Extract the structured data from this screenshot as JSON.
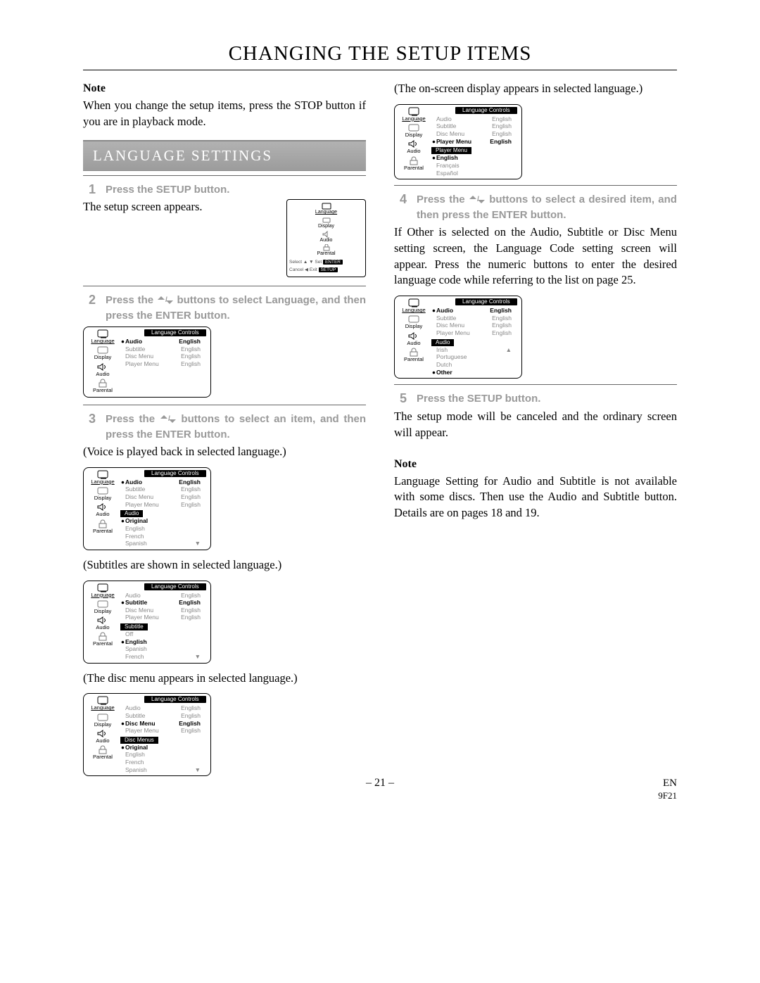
{
  "chapterTitle": "CHANGING THE SETUP ITEMS",
  "left": {
    "noteHead": "Note",
    "noteBody": "When you change the setup items, press the STOP button if you are in playback mode.",
    "sectionTitle": "LANGUAGE SETTINGS",
    "step1": {
      "num": "1",
      "txt": "Press the SETUP button.",
      "after": "The setup screen appears."
    },
    "miniOsd": {
      "items": [
        "Language",
        "Display",
        "Audio",
        "Parental"
      ],
      "footLeft": "Select",
      "footLeftTag": "ENTER",
      "footRight": "Cancel",
      "footRightTag": "SETUP",
      "exit": "Exit"
    },
    "step2": {
      "num": "2",
      "txt_a": "Press the ",
      "txt_b": " buttons to select Language, and then press the ENTER button."
    },
    "osd1": {
      "sideActive": "Language",
      "title": "Language Controls",
      "rows": [
        {
          "k": "Audio",
          "v": "English",
          "hl": true,
          "bullet": true
        },
        {
          "k": "Subtitle",
          "v": "English",
          "dim": true
        },
        {
          "k": "Disc Menu",
          "v": "English",
          "dim": true
        },
        {
          "k": "Player Menu",
          "v": "English",
          "dim": true
        }
      ]
    },
    "step3": {
      "num": "3",
      "txt_a": "Press the ",
      "txt_b": " buttons to select an item, and then press the ENTER button."
    },
    "voice": "(Voice is played back in selected language.)",
    "osd2": {
      "sideActive": "Language",
      "title": "Language Controls",
      "rows": [
        {
          "k": "Audio",
          "v": "English",
          "hl": true,
          "bullet": true
        },
        {
          "k": "Subtitle",
          "v": "English",
          "dim": true
        },
        {
          "k": "Disc Menu",
          "v": "English",
          "dim": true
        },
        {
          "k": "Player Menu",
          "v": "English",
          "dim": true
        }
      ],
      "subTitle": "Audio",
      "list": [
        {
          "lbl": "Original",
          "bullet": true,
          "hl": true
        },
        {
          "lbl": "English",
          "dim": true
        },
        {
          "lbl": "French",
          "dim": true
        },
        {
          "lbl": "Spanish",
          "dim": true,
          "down": true
        }
      ]
    },
    "subs": "(Subtitles are shown in selected language.)",
    "osd3": {
      "sideActive": "Language",
      "title": "Language Controls",
      "rows": [
        {
          "k": "Audio",
          "v": "English",
          "dim": true
        },
        {
          "k": "Subtitle",
          "v": "English",
          "hl": true,
          "bullet": true
        },
        {
          "k": "Disc Menu",
          "v": "English",
          "dim": true
        },
        {
          "k": "Player Menu",
          "v": "English",
          "dim": true
        }
      ],
      "subTitle": "Subtitle",
      "list": [
        {
          "lbl": "Off",
          "dim": true
        },
        {
          "lbl": "English",
          "bullet": true,
          "hl": true
        },
        {
          "lbl": "Spanish",
          "dim": true
        },
        {
          "lbl": "French",
          "dim": true,
          "down": true
        }
      ]
    },
    "disc": "(The disc menu appears in selected language.)",
    "osd4": {
      "sideActive": "Language",
      "title": "Language Controls",
      "rows": [
        {
          "k": "Audio",
          "v": "English",
          "dim": true
        },
        {
          "k": "Subtitle",
          "v": "English",
          "dim": true
        },
        {
          "k": "Disc Menu",
          "v": "English",
          "hl": true,
          "bullet": true
        },
        {
          "k": "Player Menu",
          "v": "English",
          "dim": true
        }
      ],
      "subTitle": "Disc Menus",
      "list": [
        {
          "lbl": "Original",
          "bullet": true,
          "hl": true
        },
        {
          "lbl": "English",
          "dim": true
        },
        {
          "lbl": "French",
          "dim": true
        },
        {
          "lbl": "Spanish",
          "dim": true,
          "down": true
        }
      ]
    }
  },
  "right": {
    "onscreen": "(The on-screen display appears in selected language.)",
    "osd5": {
      "sideActive": "Language",
      "title": "Language Controls",
      "rows": [
        {
          "k": "Audio",
          "v": "English",
          "dim": true
        },
        {
          "k": "Subtitle",
          "v": "English",
          "dim": true
        },
        {
          "k": "Disc Menu",
          "v": "English",
          "dim": true
        },
        {
          "k": "Player Menu",
          "v": "English",
          "hl": true,
          "bullet": true
        }
      ],
      "subTitle": "Player Menu",
      "list": [
        {
          "lbl": "English",
          "bullet": true,
          "hl": true
        },
        {
          "lbl": "Français",
          "dim": true
        },
        {
          "lbl": "Español",
          "dim": true
        }
      ]
    },
    "step4": {
      "num": "4",
      "txt_a": "Press the ",
      "txt_b": " buttons to select a desired item, and then press the ENTER button."
    },
    "step4After": "If Other is selected on the Audio, Subtitle or Disc Menu setting screen, the Language Code setting screen will appear. Press the numeric buttons to enter the desired language code while referring to the list on page 25.",
    "osd6": {
      "sideActive": "Language",
      "title": "Language Controls",
      "rows": [
        {
          "k": "Audio",
          "v": "English",
          "hl": true,
          "bullet": true
        },
        {
          "k": "Subtitle",
          "v": "English",
          "dim": true
        },
        {
          "k": "Disc Menu",
          "v": "English",
          "dim": true
        },
        {
          "k": "Player Menu",
          "v": "English",
          "dim": true
        }
      ],
      "subTitle": "Audio",
      "list": [
        {
          "lbl": "Irish",
          "dim": true,
          "up": true
        },
        {
          "lbl": "Portuguese",
          "dim": true
        },
        {
          "lbl": "Dutch",
          "dim": true
        },
        {
          "lbl": "Other",
          "bullet": true,
          "hl": true
        }
      ]
    },
    "step5": {
      "num": "5",
      "txt": "Press the SETUP button."
    },
    "step5After": "The setup mode will be canceled and the ordinary screen will appear.",
    "noteHead": "Note",
    "noteBody": "Language Setting for Audio and Subtitle is not available with some discs. Then use the Audio and Subtitle button. Details are on pages 18 and 19."
  },
  "footer": {
    "page": "– 21 –",
    "en": "EN",
    "code": "9F21"
  },
  "sideLabels": {
    "lang": "Language",
    "disp": "Display",
    "audio": "Audio",
    "par": "Parental"
  }
}
